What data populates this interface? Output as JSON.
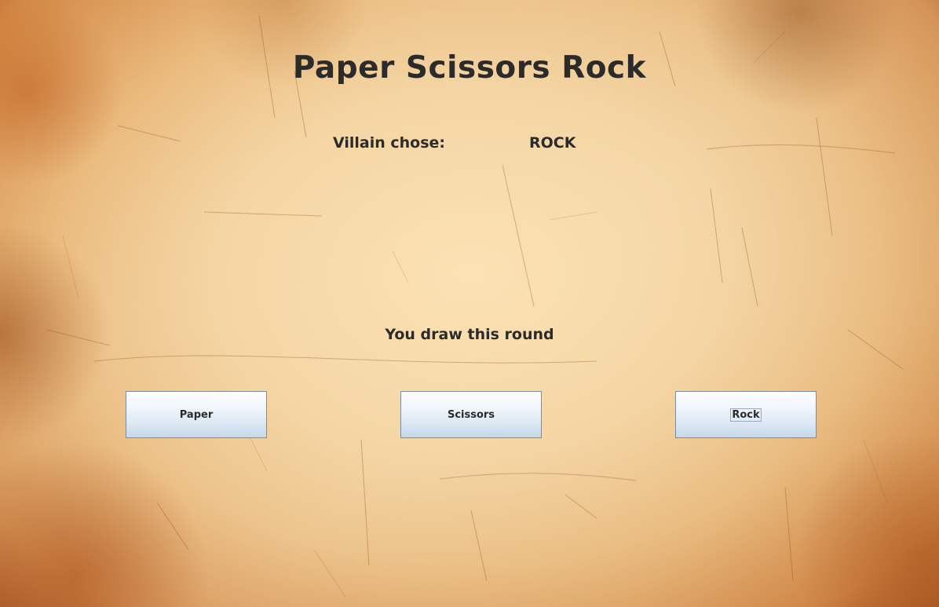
{
  "window": {
    "title": "Paper Scissors Rock"
  },
  "villain": {
    "label": "Villain chose:",
    "choice": "ROCK"
  },
  "result": {
    "message": "You draw this round"
  },
  "choices": {
    "paper": "Paper",
    "scissors": "Scissors",
    "rock": "Rock",
    "focused": "rock"
  },
  "colors": {
    "text": "#2b2b2b",
    "button_top": "#ffffff",
    "button_bottom": "#c6d8ea",
    "button_border": "#7a8ea6",
    "parchment": "#f3dbb2",
    "parchment_edge": "#a85622"
  }
}
